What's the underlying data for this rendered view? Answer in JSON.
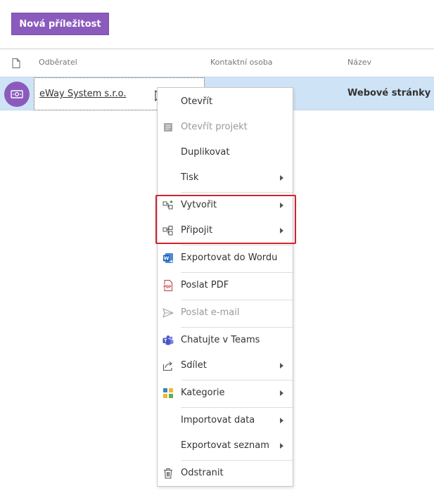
{
  "toolbar": {
    "new_button": "Nová příležitost"
  },
  "grid": {
    "columns": [
      "Odběratel",
      "Kontaktní osoba",
      "Název"
    ],
    "row": {
      "customer": "eWay System s.r.o.",
      "contact": "",
      "name": "Webové stránky"
    }
  },
  "context_menu": {
    "items": [
      {
        "label": "Otevřít",
        "icon": "",
        "disabled": false,
        "submenu": false
      },
      {
        "label": "Otevřít projekt",
        "icon": "project-icon",
        "disabled": true,
        "submenu": false
      },
      {
        "label": "Duplikovat",
        "icon": "",
        "disabled": false,
        "submenu": false
      },
      {
        "label": "Tisk",
        "icon": "",
        "disabled": false,
        "submenu": true
      },
      {
        "label": "Vytvořit",
        "icon": "create-relation-icon",
        "disabled": false,
        "submenu": true
      },
      {
        "label": "Připojit",
        "icon": "attach-relation-icon",
        "disabled": false,
        "submenu": true
      },
      {
        "label": "Exportovat do Wordu",
        "icon": "word-icon",
        "disabled": false,
        "submenu": false
      },
      {
        "label": "Poslat PDF",
        "icon": "pdf-icon",
        "disabled": false,
        "submenu": false
      },
      {
        "label": "Poslat e-mail",
        "icon": "send-icon",
        "disabled": true,
        "submenu": false
      },
      {
        "label": "Chatujte v Teams",
        "icon": "teams-icon",
        "disabled": false,
        "submenu": false
      },
      {
        "label": "Sdílet",
        "icon": "share-icon",
        "disabled": false,
        "submenu": true
      },
      {
        "label": "Kategorie",
        "icon": "category-icon",
        "disabled": false,
        "submenu": true
      },
      {
        "label": "Importovat data",
        "icon": "",
        "disabled": false,
        "submenu": true
      },
      {
        "label": "Exportovat seznam",
        "icon": "",
        "disabled": false,
        "submenu": true
      },
      {
        "label": "Odstranit",
        "icon": "trash-icon",
        "disabled": false,
        "submenu": false
      }
    ]
  },
  "colors": {
    "accent": "#8a5bbd",
    "selected_row": "#cfe3f6",
    "highlight": "#d0242e"
  }
}
